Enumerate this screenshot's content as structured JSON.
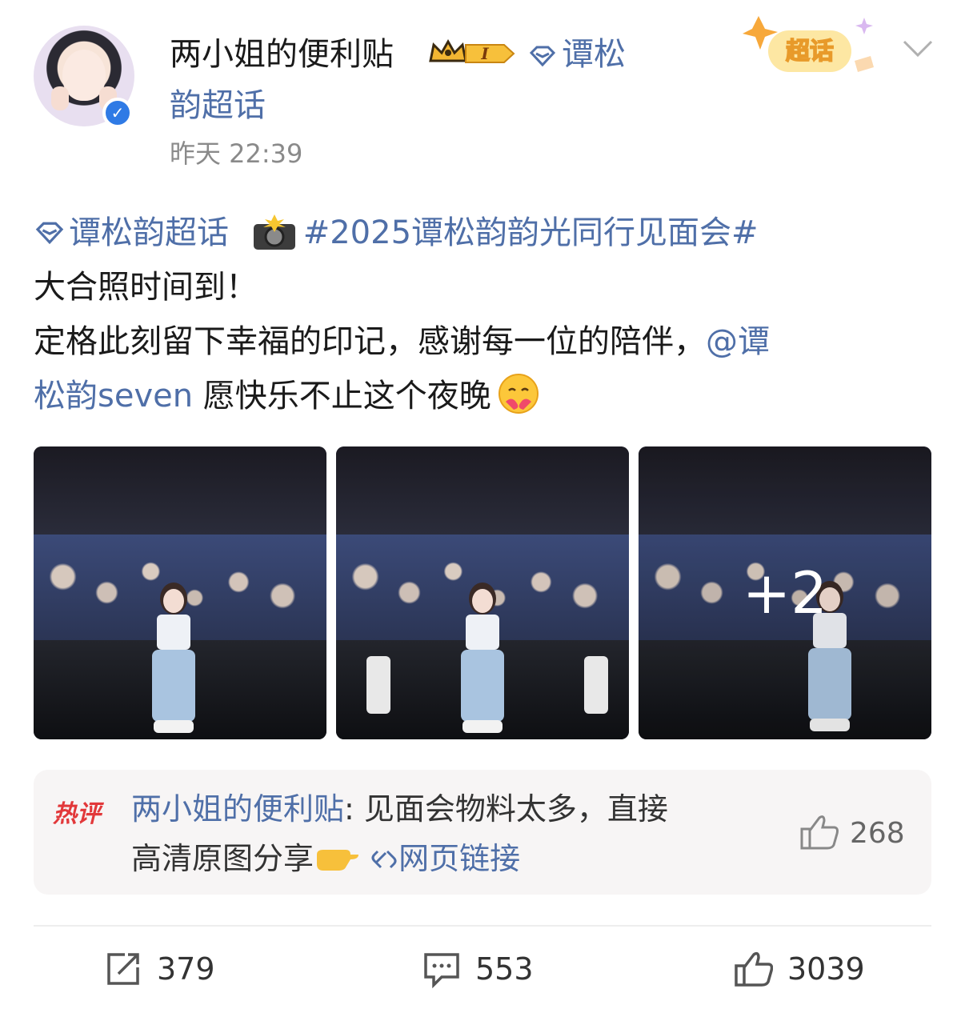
{
  "post": {
    "username": "两小姐的便利贴",
    "supertopic_part1": "谭松",
    "supertopic_part2": "韵超话",
    "time": "昨天 22:39",
    "badge_label": "超话",
    "level_badge": "I",
    "text": {
      "topic_link": "谭松韵超话",
      "hashtag": "#2025谭松韵韵光同行见面会#",
      "line2": "大合照时间到！",
      "line3_prefix": "定格此刻留下幸福的印记，感谢每一位的陪伴，",
      "mention_part1": "@谭",
      "mention_part2": "松韵seven",
      "line4_suffix": " 愿快乐不止这个夜晚"
    },
    "photos": {
      "more_count": "+2"
    },
    "hot_comment": {
      "tag": "热评",
      "author": "两小姐的便利贴",
      "text_part1": ": 见面会物料太多，直接",
      "text_part2": "高清原图分享",
      "link_label": "网页链接",
      "likes": "268"
    },
    "actions": {
      "repost_count": "379",
      "comment_count": "553",
      "like_count": "3039"
    }
  },
  "colors": {
    "link_blue": "#4f6fa8",
    "hot_red": "#e2383a",
    "verified_blue": "#2f7ae5"
  }
}
